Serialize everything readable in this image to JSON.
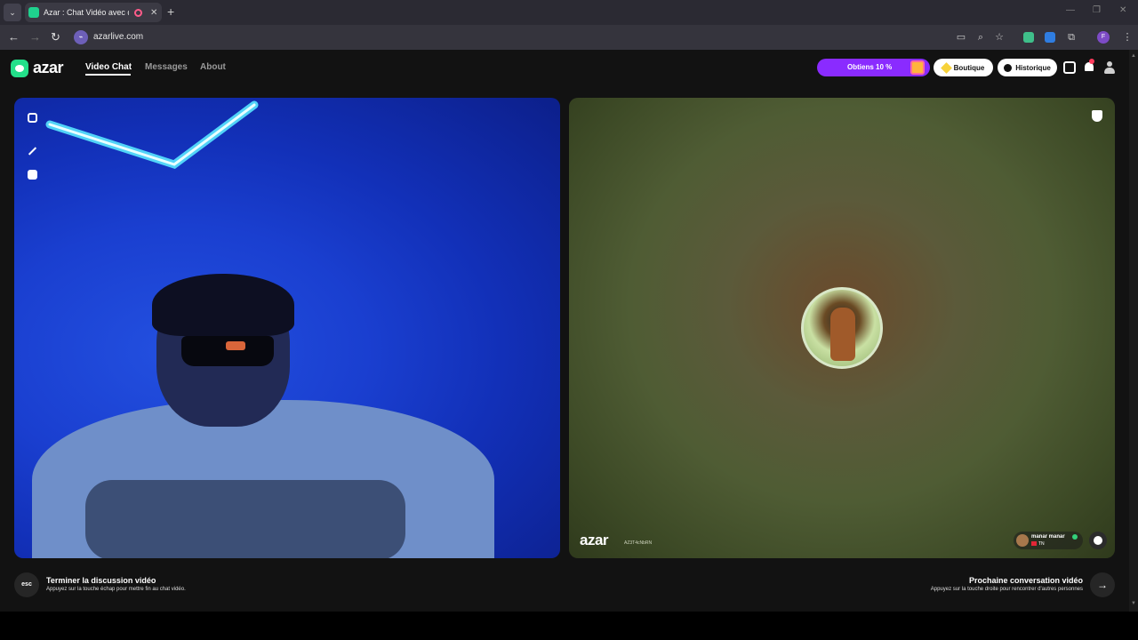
{
  "browser": {
    "tab_title": "Azar : Chat Vidéo avec de n",
    "tab_close": "✕",
    "new_tab": "+",
    "tab_menu": "⌄",
    "url": "azarlive.com",
    "profile_initial": "F",
    "window_controls": [
      "—",
      "❐",
      "✕"
    ]
  },
  "header": {
    "logo_text": "azar",
    "nav": [
      {
        "label": "Video Chat",
        "active": true
      },
      {
        "label": "Messages",
        "active": false
      },
      {
        "label": "About",
        "active": false
      }
    ],
    "promo_label": "Obtiens 10 %",
    "shop_label": "Boutique",
    "history_label": "Historique",
    "notification_count": 1
  },
  "left_video": {
    "tools": [
      "fullscreen-icon",
      "magic-wand-icon",
      "face-filter-icon"
    ]
  },
  "right_video": {
    "watermark": "azar",
    "watermark_id": "AZ3T4cNbRN",
    "peer": {
      "name": "manar manar",
      "country": "TN"
    }
  },
  "footer": {
    "esc_key": "esc",
    "end_title": "Terminer la discussion vidéo",
    "end_desc": "Appuyez sur la touche échap pour mettre fin au chat vidéo.",
    "next_title": "Prochaine conversation vidéo",
    "next_desc": "Appuyez sur la touche droite pour rencontrer d'autres personnes",
    "next_arrow": "→"
  },
  "colors": {
    "brand": "#23e08a",
    "promo": "#8a2bff",
    "background": "#121212"
  }
}
